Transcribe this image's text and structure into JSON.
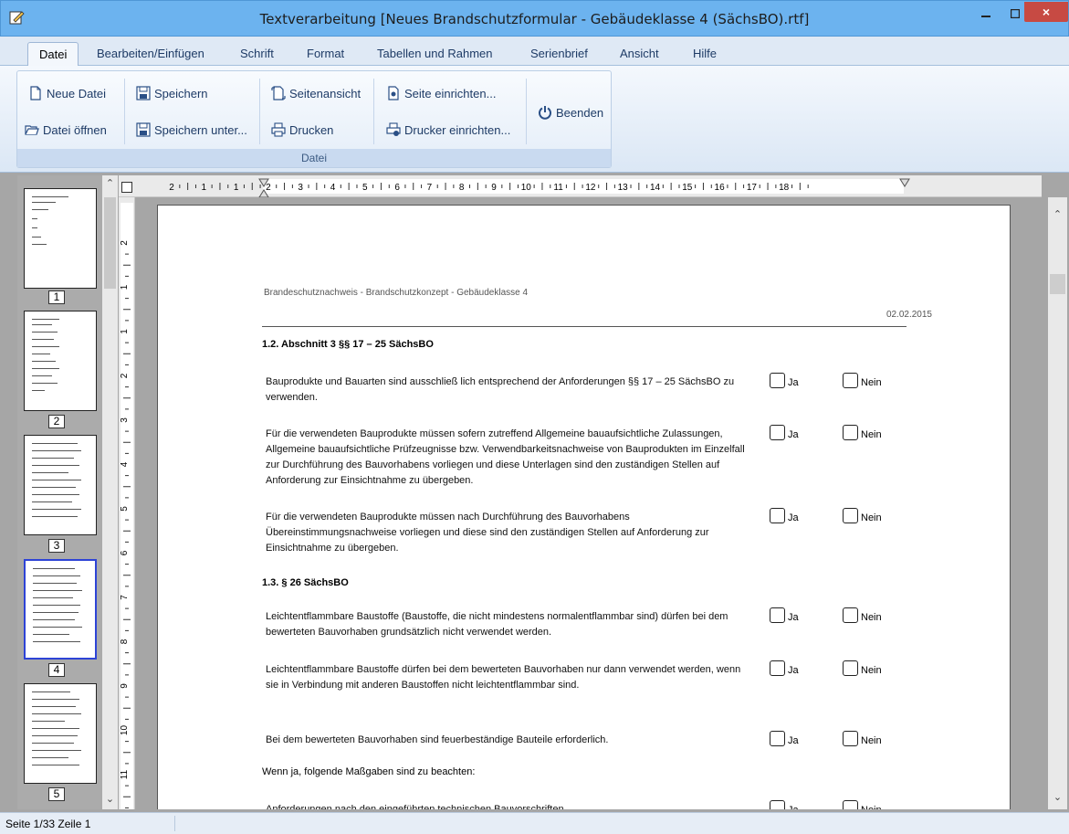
{
  "window": {
    "title": "Textverarbeitung [Neues Brandschutzformular - Gebäudeklasse 4 (SächsBO).rtf]",
    "close_label": "×"
  },
  "menu": {
    "items": [
      "Datei",
      "Bearbeiten/Einfügen",
      "Schrift",
      "Format",
      "Tabellen und Rahmen",
      "Serienbrief",
      "Ansicht",
      "Hilfe"
    ],
    "active": "Datei"
  },
  "ribbon": {
    "group_label": "Datei",
    "buttons": {
      "new_file": "Neue Datei",
      "open_file": "Datei öffnen",
      "save": "Speichern",
      "save_as": "Speichern unter...",
      "page_view": "Seitenansicht",
      "print": "Drucken",
      "page_setup": "Seite einrichten...",
      "printer_setup": "Drucker einrichten...",
      "exit": "Beenden"
    }
  },
  "thumbnails": {
    "pages": [
      "1",
      "2",
      "3",
      "4",
      "5"
    ],
    "selected": "4"
  },
  "ruler": {
    "h_labels": [
      "2",
      "1",
      "1",
      "2",
      "3",
      "4",
      "5",
      "6",
      "7",
      "8",
      "9",
      "10",
      "11",
      "12",
      "13",
      "14",
      "15",
      "16",
      "17",
      "18"
    ],
    "v_labels": [
      "2",
      "1",
      "1",
      "2",
      "3",
      "4",
      "5",
      "6",
      "7",
      "8",
      "9",
      "10",
      "11"
    ]
  },
  "document": {
    "header_text": "Brandeschutznachweis - Brandschutzkonzept - Gebäudeklasse 4",
    "date": "02.02.2015",
    "yes_label": "Ja",
    "no_label": "Nein",
    "section_1": "1.2. Abschnitt 3 §§ 17 – 25 SächsBO",
    "section_2": "1.3. § 26 SächsBO",
    "paragraphs": [
      "Bauprodukte und Bauarten sind ausschließ lich entsprechend der Anforderungen §§ 17 – 25 SächsBO zu verwenden.",
      "Für die verwendeten Bauprodukte müssen sofern zutreffend Allgemeine bauaufsichtliche Zulassungen, Allgemeine bauaufsichtliche Prüfzeugnisse bzw. Verwendbarkeitsnachweise von Bauprodukten im Einzelfall zur Durchführung des Bauvorhabens vorliegen und diese Unterlagen sind den zuständigen Stellen auf Anforderung zur Einsichtnahme zu übergeben.",
      "Für die verwendeten Bauprodukte müssen nach Durchführung des Bauvorhabens Übereinstimmungsnachweise vorliegen und diese sind den zuständigen Stellen auf Anforderung zur Einsichtnahme zu übergeben.",
      "Leichtentflammbare Baustoffe (Baustoffe, die nicht mindestens normalentflammbar sind) dürfen bei dem bewerteten Bauvorhaben grundsätzlich nicht verwendet werden.",
      "Leichtentflammbare Baustoffe dürfen bei dem bewerteten Bauvorhaben nur dann verwendet werden, wenn sie in Verbindung mit anderen Baustoffen nicht leichtentflammbar sind.",
      "Bei dem bewerteten Bauvorhaben sind feuerbeständige Bauteile erforderlich.",
      "Anforderungen nach den eingeführten technischen Bauvorschriften."
    ],
    "note": "Wenn ja, folgende Maßgaben sind zu beachten:"
  },
  "status": {
    "text": "Seite 1/33 Zeile 1"
  }
}
